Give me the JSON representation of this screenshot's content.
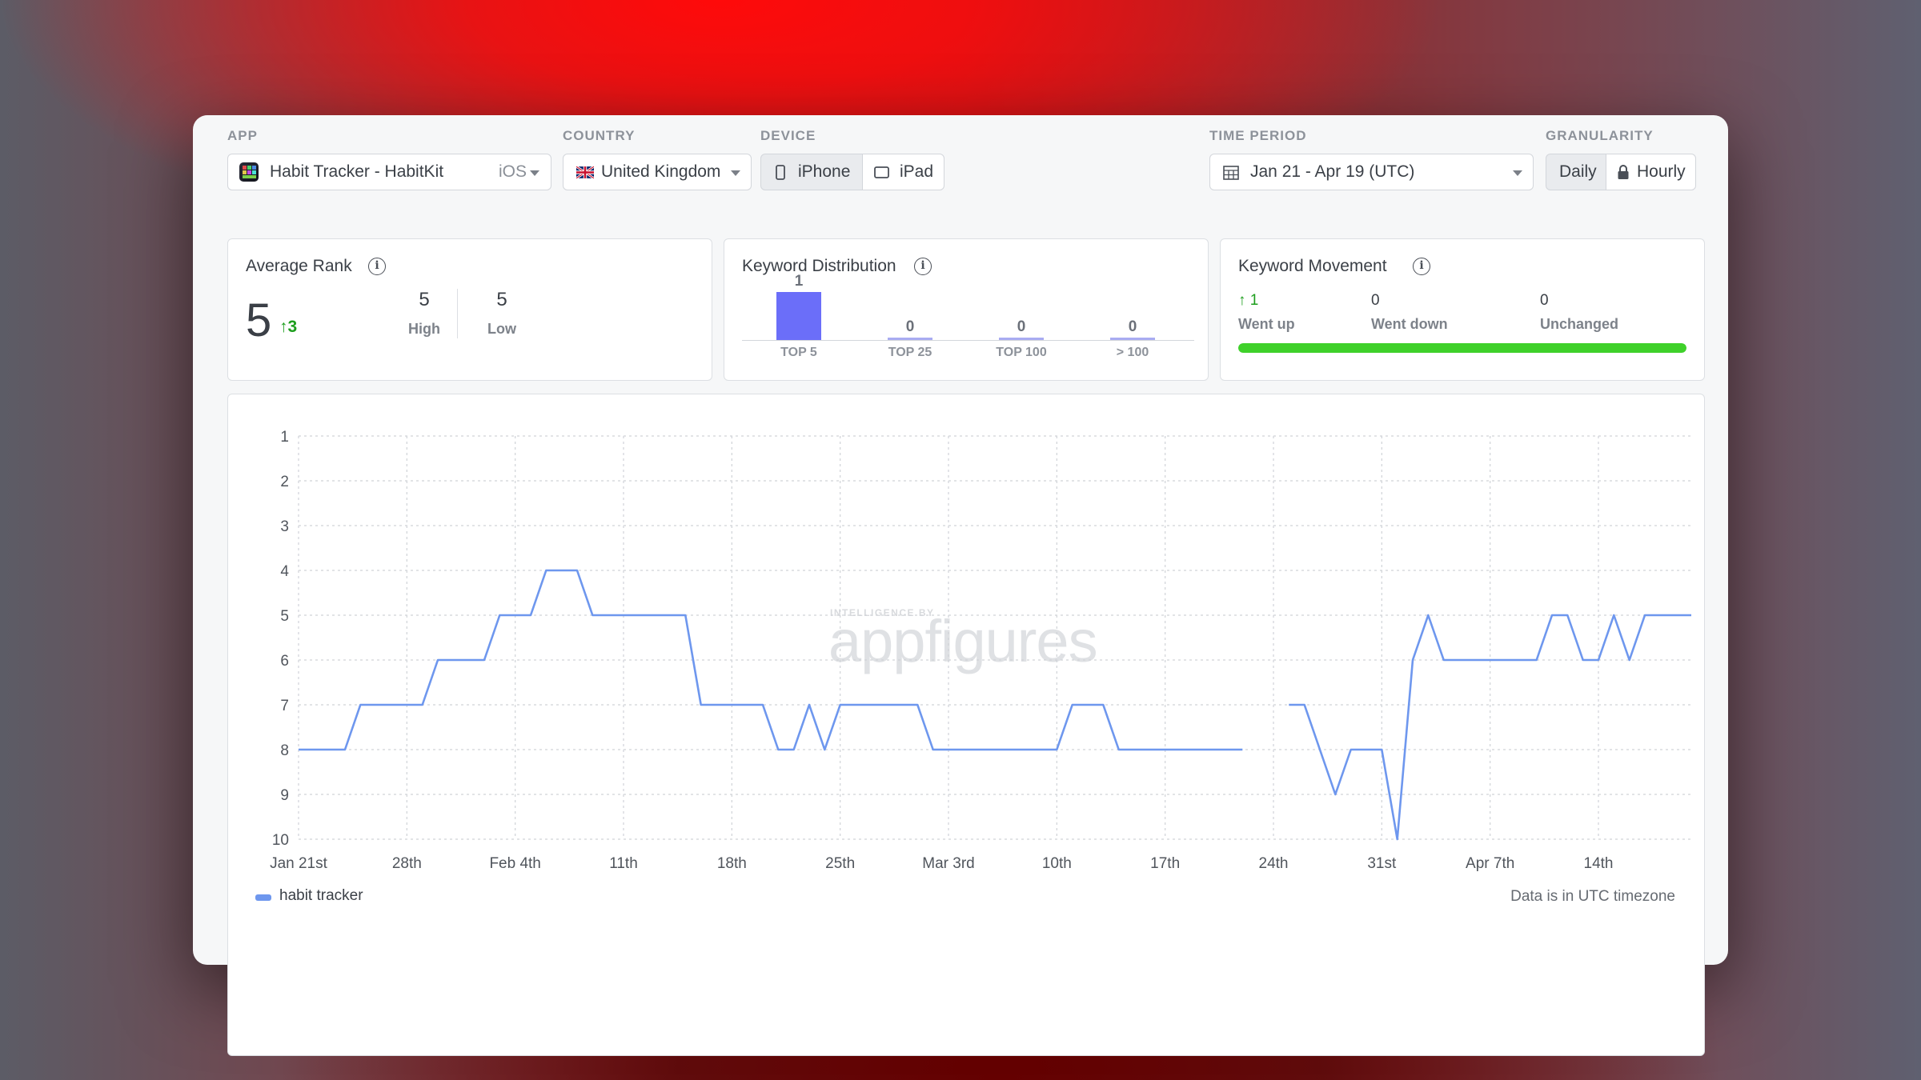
{
  "filters": {
    "app_label": "APP",
    "app_value": "Habit Tracker - HabitKit",
    "app_platform": "iOS",
    "country_label": "COUNTRY",
    "country_value": "United Kingdom",
    "device_label": "DEVICE",
    "device_iphone": "iPhone",
    "device_ipad": "iPad",
    "time_label": "TIME PERIOD",
    "time_value": "Jan 21 - Apr 19 (UTC)",
    "granularity_label": "GRANULARITY",
    "granularity_daily": "Daily",
    "granularity_hourly": "Hourly"
  },
  "average_rank": {
    "title": "Average Rank",
    "value": "5",
    "change": "3",
    "high_value": "5",
    "high_label": "High",
    "low_value": "5",
    "low_label": "Low"
  },
  "keyword_distribution": {
    "title": "Keyword Distribution",
    "buckets": [
      {
        "label": "TOP 5",
        "count": "1"
      },
      {
        "label": "TOP 25",
        "count": "0"
      },
      {
        "label": "TOP 100",
        "count": "0"
      },
      {
        "label": "> 100",
        "count": "0"
      }
    ]
  },
  "keyword_movement": {
    "title": "Keyword Movement",
    "up_value": "1",
    "up_label": "Went up",
    "down_value": "0",
    "down_label": "Went down",
    "unchanged_value": "0",
    "unchanged_label": "Unchanged",
    "up_fraction": 1.0
  },
  "watermark": {
    "small": "INTELLIGENCE BY",
    "brand": "appfigures"
  },
  "footer": {
    "legend": "habit tracker",
    "timezone_note": "Data is in UTC timezone"
  },
  "colors": {
    "accent": "#6b6ef9",
    "line": "#6e97ee",
    "green": "#3fd12a",
    "up_green": "#1d9e1d"
  },
  "icons": {
    "calendar": "calendar-icon",
    "lock": "lock-icon",
    "phone": "phone-icon",
    "tablet": "tablet-icon",
    "flag": "uk-flag-icon",
    "app": "app-icon"
  },
  "chart_data": {
    "type": "line",
    "x_ticks": [
      "Jan 21st",
      "28th",
      "Feb 4th",
      "11th",
      "18th",
      "25th",
      "Mar 3rd",
      "10th",
      "17th",
      "24th",
      "31st",
      "Apr 7th",
      "14th"
    ],
    "y_ticks": [
      "1",
      "2",
      "3",
      "4",
      "5",
      "6",
      "7",
      "8",
      "9",
      "10"
    ],
    "ylim": [
      1,
      10
    ],
    "y_inverted": true,
    "x_start": "Jan 21",
    "x_end": "Apr 19",
    "grid": true,
    "series": [
      {
        "name": "habit tracker",
        "values": [
          8,
          8,
          8,
          8,
          7,
          7,
          7,
          7,
          7,
          6,
          6,
          6,
          6,
          5,
          5,
          5,
          4,
          4,
          4,
          5,
          5,
          5,
          5,
          5,
          5,
          5,
          7,
          7,
          7,
          7,
          7,
          8,
          8,
          7,
          8,
          7,
          7,
          7,
          7,
          7,
          7,
          8,
          8,
          8,
          8,
          8,
          8,
          8,
          8,
          8,
          7,
          7,
          7,
          8,
          8,
          8,
          8,
          8,
          8,
          8,
          8,
          8,
          null,
          null,
          7,
          7,
          8,
          9,
          8,
          8,
          8,
          10,
          6,
          5,
          6,
          6,
          6,
          6,
          6,
          6,
          6,
          5,
          5,
          6,
          6,
          5,
          6,
          5,
          5,
          5,
          5
        ]
      }
    ]
  }
}
